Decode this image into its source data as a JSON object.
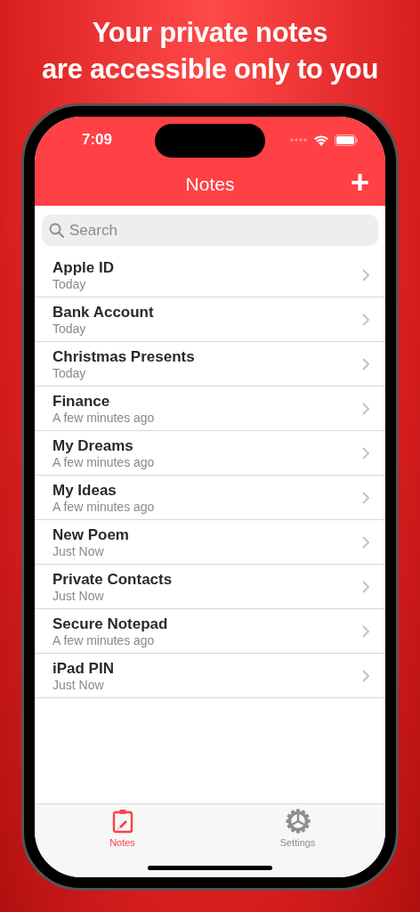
{
  "headline": [
    "Your private notes",
    "are accessible only to you"
  ],
  "status_bar": {
    "time": "7:09"
  },
  "nav": {
    "title": "Notes",
    "add_button": "+"
  },
  "search": {
    "placeholder": "Search"
  },
  "notes": [
    {
      "title": "Apple ID",
      "subtitle": "Today"
    },
    {
      "title": "Bank Account",
      "subtitle": "Today"
    },
    {
      "title": "Christmas Presents",
      "subtitle": "Today"
    },
    {
      "title": "Finance",
      "subtitle": "A few minutes ago"
    },
    {
      "title": "My Dreams",
      "subtitle": "A few minutes ago"
    },
    {
      "title": "My Ideas",
      "subtitle": "A few minutes ago"
    },
    {
      "title": "New Poem",
      "subtitle": "Just Now"
    },
    {
      "title": "Private Contacts",
      "subtitle": "Just Now"
    },
    {
      "title": "Secure Notepad",
      "subtitle": "A few minutes ago"
    },
    {
      "title": "iPad PIN",
      "subtitle": "Just Now"
    }
  ],
  "tab_bar": [
    {
      "kind": "notes",
      "label": "Notes",
      "selected": true
    },
    {
      "kind": "settings",
      "label": "Settings",
      "selected": false
    }
  ]
}
